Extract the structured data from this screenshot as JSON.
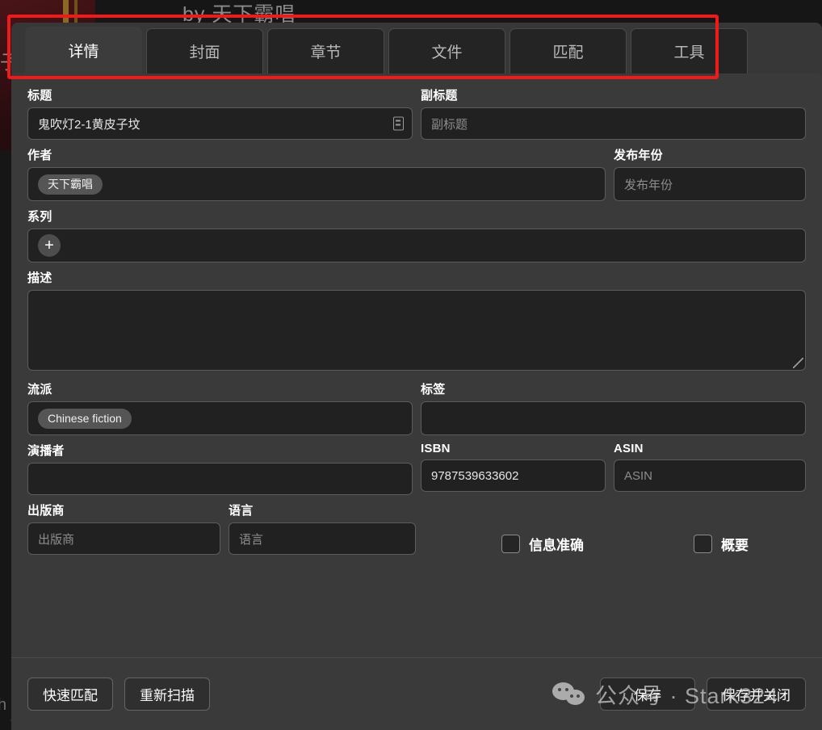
{
  "background": {
    "byline": "by 天下霸唱",
    "title_fragment": "子坟",
    "left_fragment": "h",
    "bottom_fragment": "————————————————————"
  },
  "modal": {
    "tabs": [
      {
        "label": "详情",
        "active": true
      },
      {
        "label": "封面",
        "active": false
      },
      {
        "label": "章节",
        "active": false
      },
      {
        "label": "文件",
        "active": false
      },
      {
        "label": "匹配",
        "active": false
      },
      {
        "label": "工具",
        "active": false
      }
    ],
    "fields": {
      "title": {
        "label": "标题",
        "value": "鬼吹灯2-1黄皮子坟",
        "icon": "book-icon"
      },
      "subtitle": {
        "label": "副标题",
        "value": "",
        "placeholder": "副标题"
      },
      "author": {
        "label": "作者",
        "chips": [
          "天下霸唱"
        ]
      },
      "published_year": {
        "label": "发布年份",
        "value": "",
        "placeholder": "发布年份"
      },
      "series": {
        "label": "系列",
        "add_label": "+"
      },
      "description": {
        "label": "描述",
        "value": ""
      },
      "genre": {
        "label": "流派",
        "chips": [
          "Chinese fiction"
        ]
      },
      "tags": {
        "label": "标签",
        "value": ""
      },
      "narrator": {
        "label": "演播者",
        "value": ""
      },
      "isbn": {
        "label": "ISBN",
        "value": "9787539633602"
      },
      "asin": {
        "label": "ASIN",
        "value": "",
        "placeholder": "ASIN"
      },
      "publisher": {
        "label": "出版商",
        "value": "",
        "placeholder": "出版商"
      },
      "language": {
        "label": "语言",
        "value": "",
        "placeholder": "语言"
      }
    },
    "checkboxes": [
      {
        "label": "信息准确",
        "checked": false
      },
      {
        "label": "概要",
        "checked": false
      }
    ],
    "footer": {
      "quick_match": "快速匹配",
      "rescan": "重新扫描",
      "save": "保存",
      "save_and_close": "保存并关闭"
    }
  },
  "annotation": {
    "highlight_color": "#f01a1a"
  },
  "watermark": {
    "text": "公众号 · Stark324",
    "icon": "wechat-icon"
  }
}
